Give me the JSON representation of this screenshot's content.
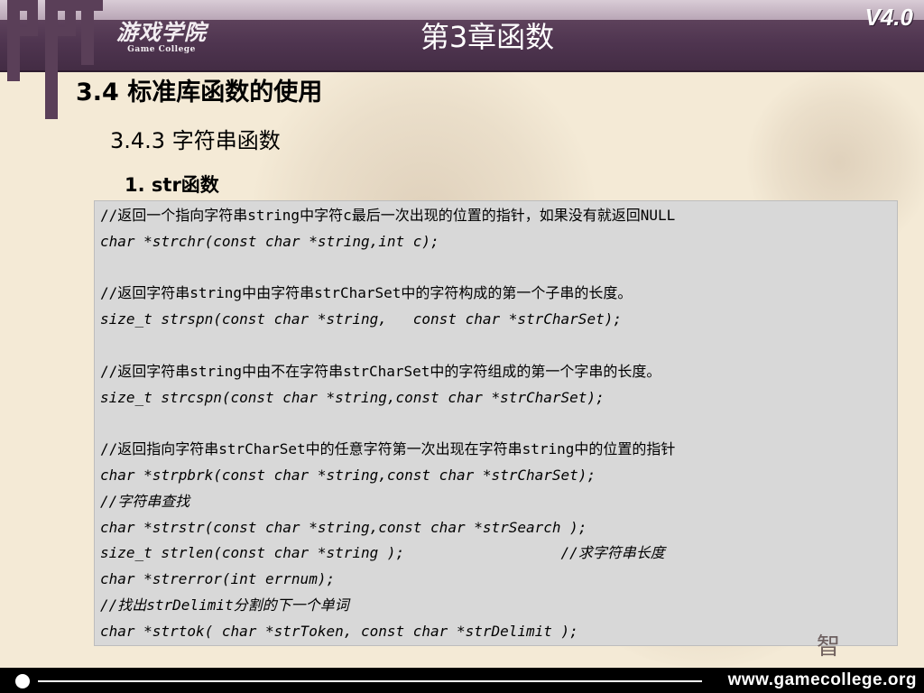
{
  "header": {
    "logo_main": "游戏学院",
    "logo_sub": "Game College",
    "chapter_title": "第3章函数",
    "version": "V4.0"
  },
  "section_title": "3.4 标准库函数的使用",
  "subsection_title": "3.4.3 字符串函数",
  "item_title": "1. str函数",
  "code_lines": [
    {
      "text": "//返回一个指向字符串string中字符c最后一次出现的位置的指针，如果没有就返回NULL",
      "italic": false
    },
    {
      "text": "char *strchr(const char *string,int c);",
      "italic": true
    },
    {
      "text": "",
      "italic": false
    },
    {
      "text": "//返回字符串string中由字符串strCharSet中的字符构成的第一个子串的长度。",
      "italic": false
    },
    {
      "text": "size_t strspn(const char *string,   const char *strCharSet);",
      "italic": true
    },
    {
      "text": "",
      "italic": false
    },
    {
      "text": "//返回字符串string中由不在字符串strCharSet中的字符组成的第一个字串的长度。",
      "italic": false
    },
    {
      "text": "size_t strcspn(const char *string,const char *strCharSet);",
      "italic": true
    },
    {
      "text": "",
      "italic": false
    },
    {
      "text": "//返回指向字符串strCharSet中的任意字符第一次出现在字符串string中的位置的指针",
      "italic": false
    },
    {
      "text": "char *strpbrk(const char *string,const char *strCharSet);",
      "italic": true
    },
    {
      "text": "//字符串查找",
      "italic": true
    },
    {
      "text": "char *strstr(const char *string,const char *strSearch );",
      "italic": true
    },
    {
      "text": "size_t strlen(const char *string );                  //求字符串长度",
      "italic": true
    },
    {
      "text": "char *strerror(int errnum);",
      "italic": true
    },
    {
      "text": "//找出strDelimit分割的下一个单词",
      "italic": true
    },
    {
      "text": "char *strtok( char *strToken, const char *strDelimit );",
      "italic": true
    }
  ],
  "watermark": "智",
  "footer": {
    "url": "www.gamecollege.org"
  },
  "colors": {
    "header_bg": "#4f3550",
    "page_bg": "#f4ead6",
    "code_bg": "#d8d8d8",
    "footer_bg": "#000000"
  }
}
